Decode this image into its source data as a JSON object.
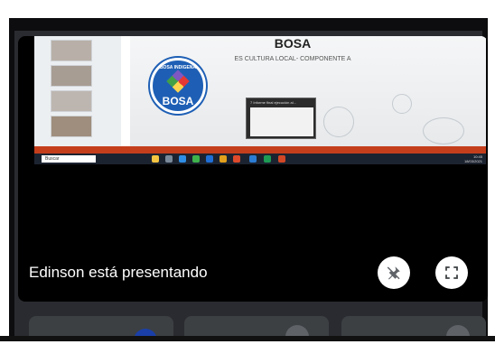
{
  "shared_screen": {
    "slide_title": "BOSA",
    "slide_subtitle": "ES CULTURA LOCAL- COMPONENTE A",
    "logo_top_text": "BOSA INDIGENA",
    "logo_bottom_text": "BOSA",
    "popup_label": "7 Informe final ejecución al...",
    "taskbar_search": "Buscar",
    "clock": "10:45",
    "date": "18/03/2021"
  },
  "presenter_text": "Edinson está presentando",
  "colors": {
    "meet_background": "#2a2b30",
    "present_background": "#000000",
    "tile_background": "#3c4043",
    "ppt_status": "#c43e1c",
    "logo_blue": "#1e5fb5"
  },
  "icons": {
    "unpin": "pin-off-icon",
    "fullscreen": "fullscreen-icon",
    "mic_off": "mic-off-icon"
  }
}
